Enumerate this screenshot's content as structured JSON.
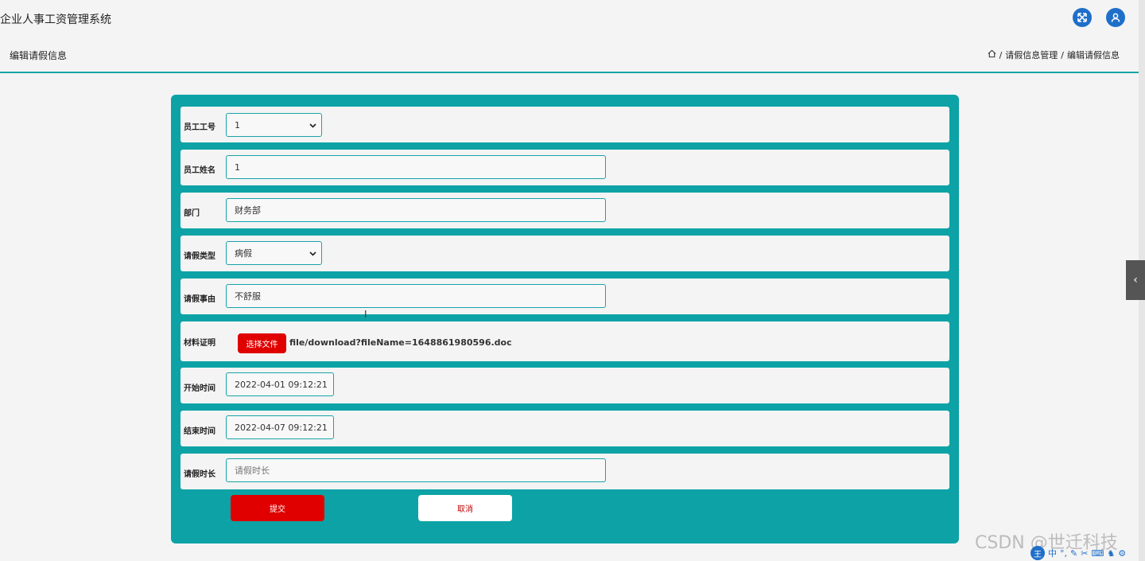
{
  "app": {
    "title": "企业人事工资管理系统"
  },
  "header_icons": {
    "fullscreen": "fullscreen-icon",
    "user": "user-icon"
  },
  "page": {
    "title": "编辑请假信息",
    "breadcrumb": [
      "请假信息管理",
      "编辑请假信息"
    ],
    "breadcrumb_sep": "/"
  },
  "form": {
    "employee_id": {
      "label": "员工工号",
      "value": "1"
    },
    "employee_name": {
      "label": "员工姓名",
      "value": "1"
    },
    "department": {
      "label": "部门",
      "value": "财务部"
    },
    "leave_type": {
      "label": "请假类型",
      "value": "病假"
    },
    "reason": {
      "label": "请假事由",
      "value": "不舒服"
    },
    "material": {
      "label": "材料证明",
      "button": "选择文件",
      "filename": "file/download?fileName=1648861980596.doc"
    },
    "start_time": {
      "label": "开始时间",
      "value": "2022-04-01 09:12:21"
    },
    "end_time": {
      "label": "结束时间",
      "value": "2022-04-07 09:12:21"
    },
    "duration": {
      "label": "请假时长",
      "placeholder": "请假时长"
    }
  },
  "buttons": {
    "submit": "提交",
    "cancel": "取消"
  },
  "watermark": "CSDN @世迁科技",
  "ime": {
    "main": "王",
    "mode": "中"
  },
  "colors": {
    "accent": "#19a3a8",
    "panel": "#0da3a6",
    "danger": "#e00000",
    "icon_blue": "#1f6fc9"
  }
}
